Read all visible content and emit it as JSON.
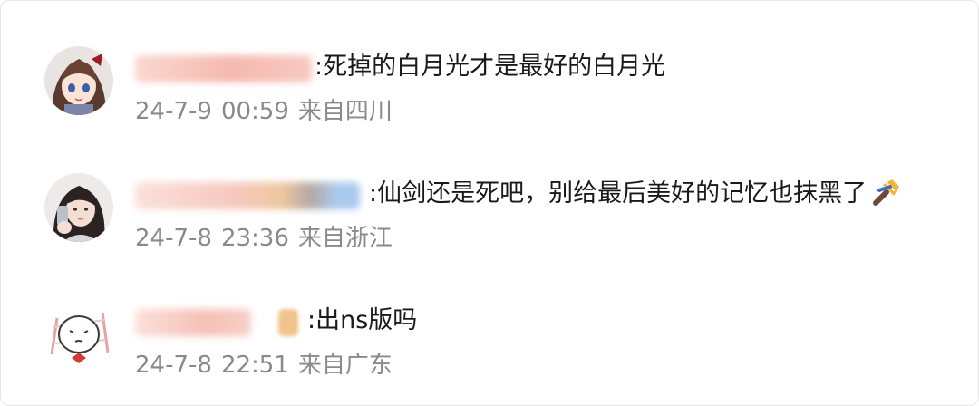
{
  "comments": [
    {
      "text": ":死掉的白月光才是最好的白月光",
      "date": "24-7-9",
      "time": "00:59",
      "location": "来自四川",
      "avatar_icon": "anime-girl-avatar-icon"
    },
    {
      "text": ":仙剑还是死吧，别给最后美好的记忆也抹黑了",
      "date": "24-7-8",
      "time": "23:36",
      "location": "来自浙江",
      "avatar_icon": "selfie-girl-avatar-icon",
      "emoji_icon": "hammer-emoji-icon"
    },
    {
      "text": ":出ns版吗",
      "date": "24-7-8",
      "time": "22:51",
      "location": "来自广东",
      "avatar_icon": "doodle-face-avatar-icon"
    }
  ],
  "colors": {
    "text": "#1a1a1a",
    "meta": "#8a8a8a",
    "blur_pink": "#f7c9c1",
    "blur_orange": "#f0c48a",
    "blur_blue": "#a9c9ef"
  }
}
